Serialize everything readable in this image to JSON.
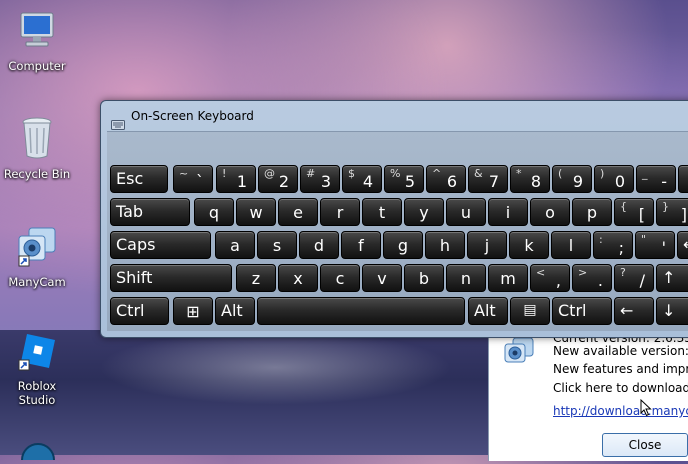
{
  "desktop": {
    "icons": [
      {
        "name": "Computer",
        "icon": "computer-icon"
      },
      {
        "name": "Recycle Bin",
        "icon": "recycle-bin-icon"
      },
      {
        "name": "ManyCam",
        "icon": "manycam-icon"
      },
      {
        "name": "Roblox\nStudio",
        "icon": "roblox-studio-icon"
      }
    ]
  },
  "osk": {
    "title": "On-Screen Keyboard",
    "row1": [
      {
        "shift": "",
        "main": "Esc"
      },
      {
        "shift": "~",
        "main": "`"
      },
      {
        "shift": "!",
        "main": "1"
      },
      {
        "shift": "@",
        "main": "2"
      },
      {
        "shift": "#",
        "main": "3"
      },
      {
        "shift": "$",
        "main": "4"
      },
      {
        "shift": "%",
        "main": "5"
      },
      {
        "shift": "^",
        "main": "6"
      },
      {
        "shift": "&",
        "main": "7"
      },
      {
        "shift": "*",
        "main": "8"
      },
      {
        "shift": "(",
        "main": "9"
      },
      {
        "shift": ")",
        "main": "0"
      },
      {
        "shift": "_",
        "main": "-"
      },
      {
        "shift": "",
        "main": ""
      }
    ],
    "row2": [
      {
        "shift": "",
        "main": "Tab"
      },
      {
        "shift": "",
        "main": "q"
      },
      {
        "shift": "",
        "main": "w"
      },
      {
        "shift": "",
        "main": "e"
      },
      {
        "shift": "",
        "main": "r"
      },
      {
        "shift": "",
        "main": "t"
      },
      {
        "shift": "",
        "main": "y"
      },
      {
        "shift": "",
        "main": "u"
      },
      {
        "shift": "",
        "main": "i"
      },
      {
        "shift": "",
        "main": "o"
      },
      {
        "shift": "",
        "main": "p"
      },
      {
        "shift": "{",
        "main": "["
      },
      {
        "shift": "}",
        "main": "]"
      }
    ],
    "row3": [
      {
        "shift": "",
        "main": "Caps"
      },
      {
        "shift": "",
        "main": "a"
      },
      {
        "shift": "",
        "main": "s"
      },
      {
        "shift": "",
        "main": "d"
      },
      {
        "shift": "",
        "main": "f"
      },
      {
        "shift": "",
        "main": "g"
      },
      {
        "shift": "",
        "main": "h"
      },
      {
        "shift": "",
        "main": "j"
      },
      {
        "shift": "",
        "main": "k"
      },
      {
        "shift": "",
        "main": "l"
      },
      {
        "shift": ":",
        "main": ";"
      },
      {
        "shift": "\"",
        "main": "'"
      },
      {
        "shift": "",
        "main": "←"
      }
    ],
    "row4": [
      {
        "shift": "",
        "main": "Shift"
      },
      {
        "shift": "",
        "main": "z"
      },
      {
        "shift": "",
        "main": "x"
      },
      {
        "shift": "",
        "main": "c"
      },
      {
        "shift": "",
        "main": "v"
      },
      {
        "shift": "",
        "main": "b"
      },
      {
        "shift": "",
        "main": "n"
      },
      {
        "shift": "",
        "main": "m"
      },
      {
        "shift": "<",
        "main": ","
      },
      {
        "shift": ">",
        "main": "."
      },
      {
        "shift": "?",
        "main": "/"
      },
      {
        "shift": "",
        "main": "↑"
      }
    ],
    "row5": [
      {
        "shift": "",
        "main": "Ctrl"
      },
      {
        "shift": "",
        "main": "⊞"
      },
      {
        "shift": "",
        "main": "Alt"
      },
      {
        "shift": "",
        "main": ""
      },
      {
        "shift": "",
        "main": "Alt"
      },
      {
        "shift": "",
        "main": "▤"
      },
      {
        "shift": "",
        "main": "Ctrl"
      },
      {
        "shift": "",
        "main": "←"
      },
      {
        "shift": "",
        "main": "↓"
      }
    ]
  },
  "dialog": {
    "current_version": "Current version: 2.6.35",
    "new_version": "New available version:",
    "features": "New features and impro",
    "click_here": "Click here to download",
    "link": "http://download.manyca",
    "close_label": "Close"
  }
}
